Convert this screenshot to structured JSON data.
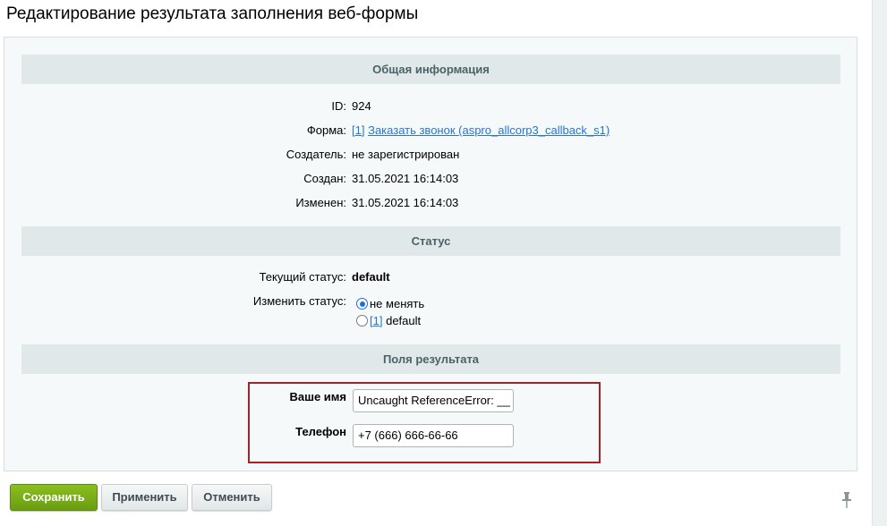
{
  "page": {
    "title": "Редактирование результата заполнения веб-формы"
  },
  "sections": {
    "general": {
      "header": "Общая информация"
    },
    "status": {
      "header": "Статус"
    },
    "fields": {
      "header": "Поля результата"
    }
  },
  "general": {
    "id_label": "ID:",
    "id_value": "924",
    "form_label": "Форма:",
    "form_id_link": "[1]",
    "form_name_link": "Заказать звонок (aspro_allcorp3_callback_s1)",
    "creator_label": "Создатель:",
    "creator_value": "не зарегистрирован",
    "created_label": "Создан:",
    "created_value": "31.05.2021 16:14:03",
    "modified_label": "Изменен:",
    "modified_value": "31.05.2021 16:14:03"
  },
  "status": {
    "current_label": "Текущий статус:",
    "current_value": "default",
    "change_label": "Изменить статус:",
    "options": [
      {
        "label": "не менять",
        "checked": true
      },
      {
        "id_link": "[1]",
        "label": "default",
        "checked": false
      }
    ]
  },
  "fields": {
    "name_label": "Ваше имя",
    "name_value": "Uncaught ReferenceError: __",
    "phone_label": "Телефон",
    "phone_value": "+7 (666) 666-66-66"
  },
  "buttons": {
    "save": "Сохранить",
    "apply": "Применить",
    "cancel": "Отменить"
  },
  "icons": {
    "pin": "pin-icon"
  },
  "colors": {
    "save_button": "#7aad17",
    "link": "#2675d7",
    "highlight_border": "#a52227",
    "section_header_bg": "#e1e8ea"
  }
}
